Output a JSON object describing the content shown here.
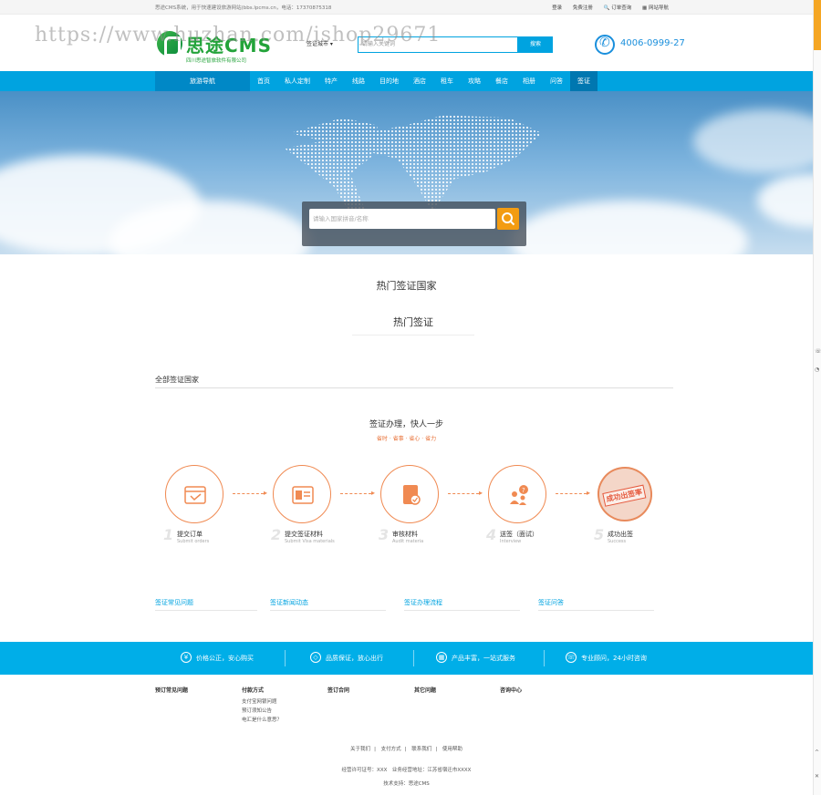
{
  "topbar": {
    "intro": "思途CMS系统，用于快速建设旅游网站(bbs.lpcms.cn，电话：17370875318",
    "links": [
      "登录",
      "免费注册",
      "订单查询",
      "网站导航"
    ]
  },
  "header": {
    "logo_name": "思途CMS",
    "logo_sub": "四川思途智旅软件有限公司",
    "search_category": "签证城市",
    "search_placeholder": "请输入关键词",
    "search_button": "搜索",
    "phone": "4006-0999-27"
  },
  "watermark": "https://www.huzhan.com/ishop29671",
  "nav": {
    "guide": "旅游导航",
    "items": [
      "首页",
      "私人定制",
      "特产",
      "线路",
      "目的地",
      "酒店",
      "租车",
      "攻略",
      "餐店",
      "相册",
      "问答",
      "签证"
    ],
    "active_index": 11
  },
  "banner": {
    "search_placeholder": "请输入国家拼音/名称"
  },
  "sections": {
    "hot_countries": "热门签证国家",
    "hot_visa": "热门签证",
    "all_countries": "全部签证国家"
  },
  "process": {
    "title": "签证办理，快人一步",
    "subtitle": "省时 · 省事 · 省心 · 省力",
    "steps": [
      {
        "num": "1",
        "label": "提交订单",
        "en": "Submit orders",
        "icon": "order-icon"
      },
      {
        "num": "2",
        "label": "提交签证材料",
        "en": "Submit Visa materials",
        "icon": "materials-icon"
      },
      {
        "num": "3",
        "label": "审核材料",
        "en": "Audit materia",
        "icon": "audit-icon"
      },
      {
        "num": "4",
        "label": "送签（面试）",
        "en": "Interview",
        "icon": "interview-icon"
      },
      {
        "num": "5",
        "label": "成功出签",
        "en": "Success",
        "icon": "success-stamp"
      }
    ],
    "stamp_text": "成功出签率"
  },
  "columns": [
    "签证常见问题",
    "签证新闻动态",
    "签证办理流程",
    "签证问答"
  ],
  "promises": [
    {
      "icon": "yen-icon",
      "glyph": "¥",
      "text": "价格公正，安心购买"
    },
    {
      "icon": "diamond-icon",
      "glyph": "◇",
      "text": "品质保证，放心出行"
    },
    {
      "icon": "grid-icon",
      "glyph": "▦",
      "text": "产品丰富，一站式服务"
    },
    {
      "icon": "headset-icon",
      "glyph": "☏",
      "text": "专业顾问，24小时咨询"
    }
  ],
  "footer": {
    "cols": [
      {
        "title": "预订常见问题",
        "items": []
      },
      {
        "title": "付款方式",
        "items": [
          "支付宝网银问题",
          "预订须知公告",
          "电汇是什么意思？"
        ]
      },
      {
        "title": "签订合同",
        "items": []
      },
      {
        "title": "其它问题",
        "items": []
      },
      {
        "title": "咨询中心",
        "items": []
      }
    ],
    "links": [
      "关于我们",
      "支付方式",
      "联系我们",
      "使用帮助"
    ],
    "license": "经营许可证号：XXX　业务经营地址：江苏省宿迁市XXXX",
    "tech": "技术支持：思途CMS"
  },
  "colors": {
    "primary": "#00a3e0",
    "accent": "#f08a52",
    "search_button": "#f39c12",
    "logo_green": "#23a33a"
  }
}
